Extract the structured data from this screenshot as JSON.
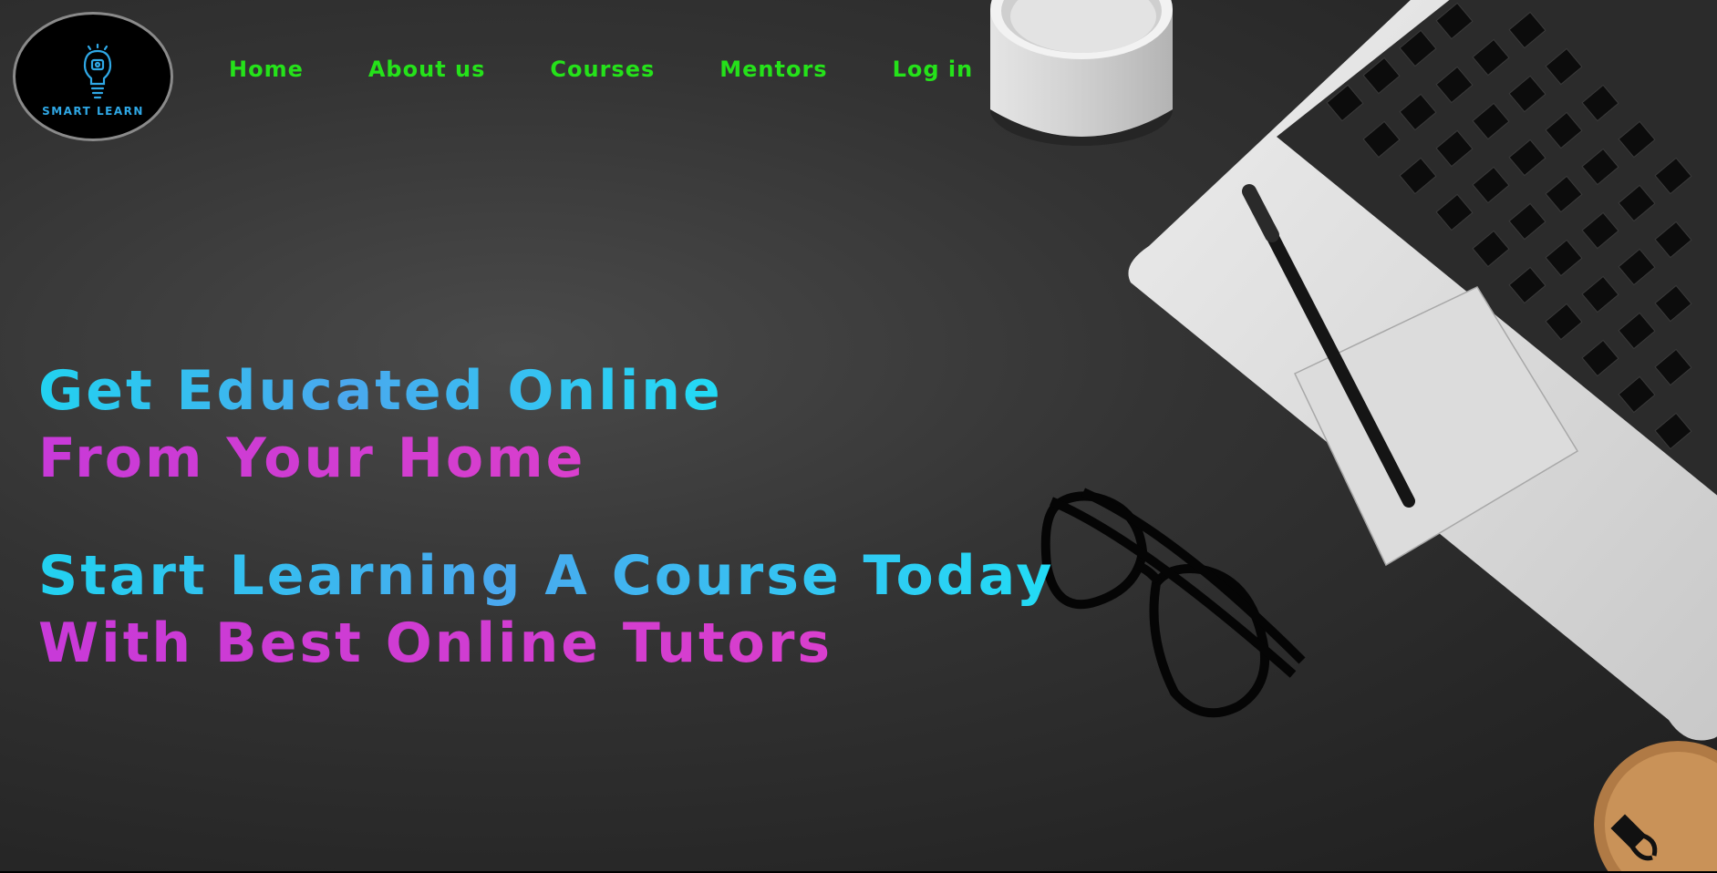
{
  "logo": {
    "text": "SMART LEARN",
    "icon": "lightbulb-icon",
    "accent": "#2fa8e6"
  },
  "nav": {
    "color": "#25e21a",
    "items": [
      {
        "label": "Home"
      },
      {
        "label": "About us"
      },
      {
        "label": "Courses"
      },
      {
        "label": "Mentors"
      },
      {
        "label": "Log in"
      }
    ]
  },
  "hero": {
    "headline1": {
      "line1": "Get Educated Online",
      "line2": "From Your Home"
    },
    "headline2": {
      "line1": "Start Learning A Course Today",
      "line2": "With Best Online Tutors"
    },
    "colors": {
      "blue": "#22d2f0",
      "pink": "#d43ecf"
    }
  }
}
